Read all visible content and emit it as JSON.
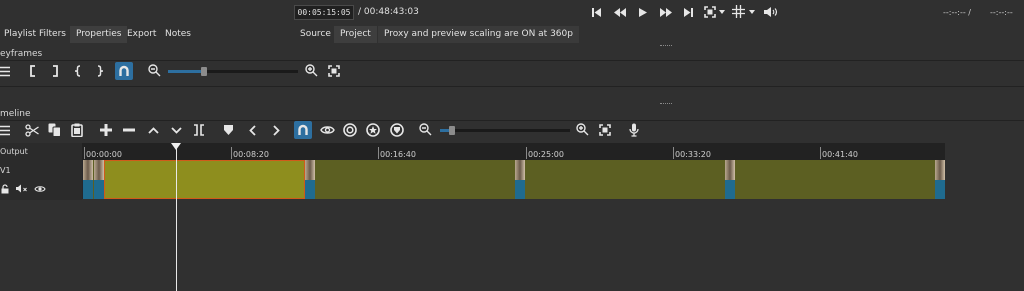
{
  "transport": {
    "position": "00:05:15:05",
    "duration": "/ 00:48:43:03",
    "right_readout": "--:--:-- /",
    "right_readout2": "--:--:--"
  },
  "tabs": {
    "left": [
      "Playlist",
      "Filters",
      "Properties",
      "Export",
      "Notes"
    ],
    "active_left": "Properties",
    "player": [
      "Source",
      "Project"
    ],
    "active_player": "Project",
    "proxy_notice": "Proxy and preview scaling are ON at 360p"
  },
  "keyframes": {
    "title": "eyframes",
    "zoom_level": 0.28
  },
  "timeline": {
    "title": "meline",
    "zoom_level": 0.09,
    "output_label": "Output",
    "track_name": "V1",
    "ruler": [
      "00:00:00",
      "00:08:20",
      "00:16:40",
      "00:25:00",
      "00:33:20",
      "00:41:40"
    ]
  },
  "colors": {
    "background": "#303030",
    "clip": "#5c5f22",
    "clip_selected": "#8e8e1e",
    "accent": "#2d6fa0",
    "selection_border": "#d05a1a"
  }
}
